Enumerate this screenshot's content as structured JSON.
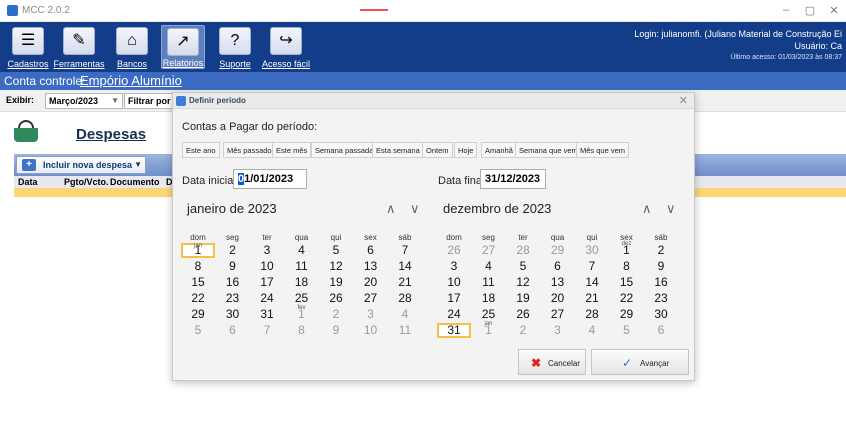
{
  "app": {
    "title": "MCC 2.0.2"
  },
  "window": {
    "min": "–",
    "max": "▢",
    "close": "✕"
  },
  "toolbar": {
    "buttons": [
      {
        "label": "Cadastros",
        "glyph": "☰"
      },
      {
        "label": "Ferramentas",
        "glyph": "✎"
      },
      {
        "label": "Bancos",
        "glyph": "⌂"
      },
      {
        "label": "Relatórios",
        "glyph": "↗"
      },
      {
        "label": "Suporte",
        "glyph": "?"
      },
      {
        "label": "Acesso fácil",
        "glyph": "↪"
      }
    ],
    "login_line": "Login: julianomfi. (Juliano Material de Construção Ei",
    "user_line": "Usuário: Ca",
    "last_access": "Último acesso: 01/03/2023 às 08:37"
  },
  "conta": {
    "label": "Conta controle:",
    "value": "Empório Alumínio"
  },
  "filter": {
    "exibir_label": "Exibir:",
    "exibir_value": "Março/2023",
    "filtrar_label": "Filtrar por da"
  },
  "main": {
    "title": "Despesas",
    "incluir": "Incluir nova despesa",
    "columns": [
      "Data",
      "Pgto/Vcto.",
      "Documento",
      "D"
    ]
  },
  "dialog": {
    "title": "Definir período",
    "contas_label": "Contas a Pagar do período:",
    "period_buttons": [
      "Este ano",
      "Mês passado",
      "Este mês",
      "Semana passada",
      "Esta semana",
      "Ontem",
      "Hoje",
      "Amanhã",
      "Semana que vem",
      "Mês que vem"
    ],
    "start_label": "Data inicial:",
    "start_caret": "0",
    "start_rest": "1/01/2023",
    "end_label": "Data final:",
    "end_value": "31/12/2023",
    "cal_start_title": "janeiro de 2023",
    "cal_end_title": "dezembro de 2023",
    "nav_up": "∧",
    "nav_down": "∨",
    "weekdays": [
      "dom",
      "seg",
      "ter",
      "qua",
      "qui",
      "sex",
      "sáb"
    ],
    "tags": {
      "jan": "jan",
      "fev": "fev",
      "dez": "dez"
    },
    "cancel": "Cancelar",
    "advance": "Avançar"
  }
}
